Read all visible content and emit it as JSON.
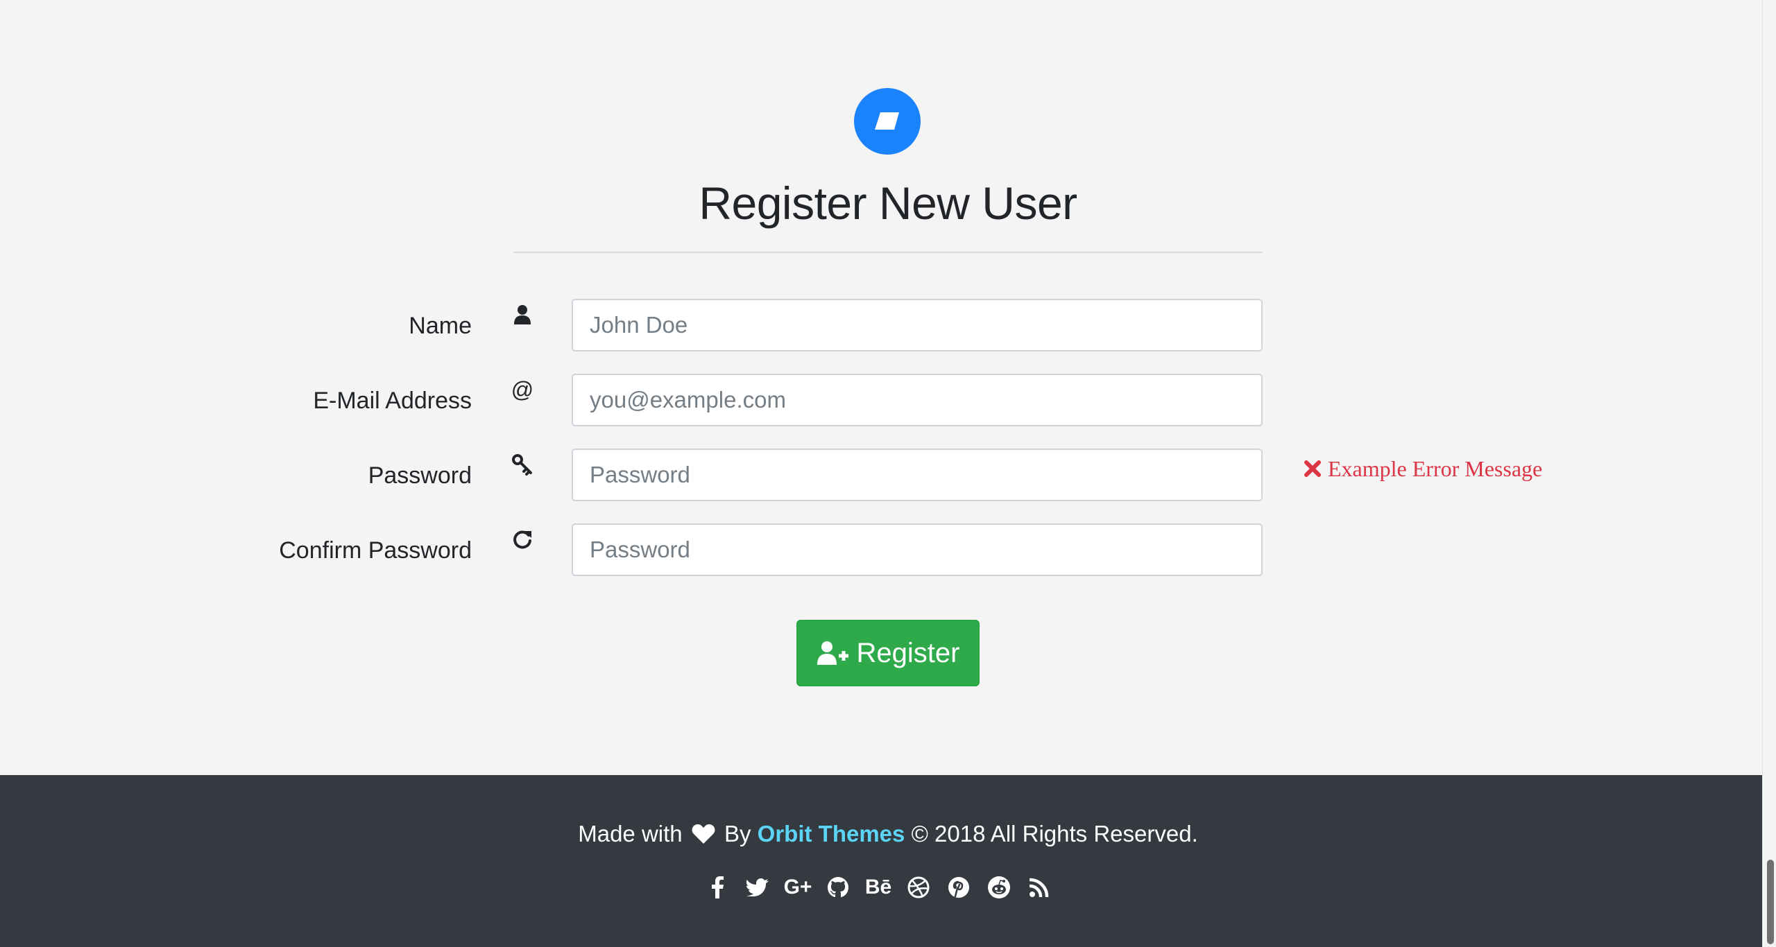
{
  "header": {
    "logo_icon": "parallelogram-logo-icon",
    "title": "Register New User"
  },
  "form": {
    "fields": [
      {
        "label": "Name",
        "icon": "user-icon",
        "placeholder": "John Doe",
        "value": ""
      },
      {
        "label": "E-Mail Address",
        "icon": "at-icon",
        "placeholder": "you@example.com",
        "value": ""
      },
      {
        "label": "Password",
        "icon": "key-icon",
        "placeholder": "Password",
        "value": ""
      },
      {
        "label": "Confirm Password",
        "icon": "refresh-icon",
        "placeholder": "Password",
        "value": ""
      }
    ],
    "error_message": "Example Error Message",
    "submit_label": "Register"
  },
  "footer": {
    "made_with": "Made with",
    "by": "By",
    "brand": "Orbit Themes",
    "rights": "© 2018 All Rights Reserved.",
    "social_icons": [
      "facebook-icon",
      "twitter-icon",
      "google-plus-icon",
      "github-icon",
      "behance-icon",
      "dribbble-icon",
      "pinterest-icon",
      "reddit-icon",
      "rss-icon"
    ],
    "google_plus_text": "G+",
    "behance_text": "Bē"
  },
  "colors": {
    "accent": "#1a82fb",
    "success": "#2eaa4a",
    "danger": "#dc3545",
    "footer_bg": "#343a40",
    "brand_link": "#5bd4f5"
  }
}
